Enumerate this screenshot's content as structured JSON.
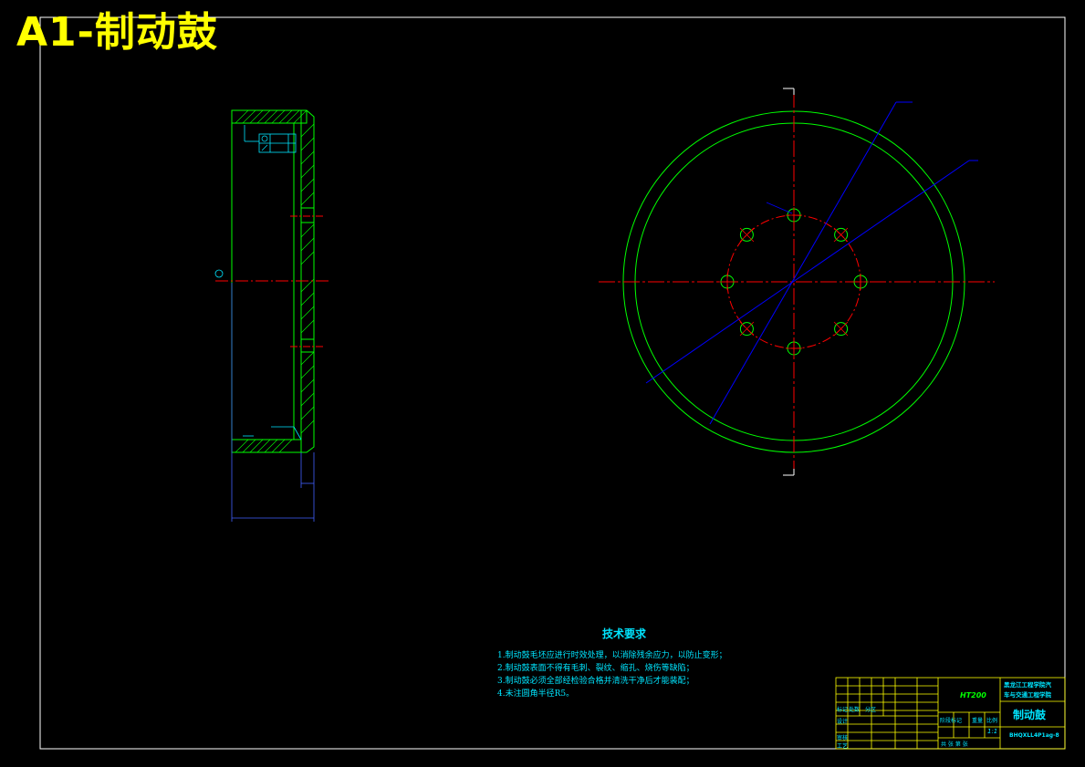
{
  "drawing": {
    "title": "A1-制动鼓",
    "colors": {
      "background": "#000000",
      "frame": "#ffffff",
      "outline": "#00ff00",
      "centerline": "#ff0000",
      "dimension": "#00e5ff",
      "leader": "#0000ff",
      "title": "#ffff00"
    }
  },
  "technical_requirements": {
    "heading": "技术要求",
    "items": [
      "1.制动鼓毛坯应进行时效处理，以消除残余应力，以防止变形；",
      "2.制动鼓表面不得有毛刺、裂纹、缩孔、烧伤等缺陷；",
      "3.制动鼓必须全部经检验合格并清洗干净后才能装配；",
      "4.未注圆角半径R5。"
    ]
  },
  "title_block": {
    "school_line1": "黑龙江工程学院汽",
    "school_line2": "车与交通工程学院",
    "part_name": "制动鼓",
    "material": "HT200",
    "drawing_code": "BHQXLL4P1ag-8",
    "scale": "1:1",
    "cols_label": "阶段标记",
    "weight_label": "重量",
    "ratio_label": "比例",
    "sheet_info": "共 张  第 张",
    "design_label": "设计",
    "mark_label": "标记",
    "count_label": "处数",
    "zone_label": "分区",
    "review_label": "审核",
    "process_label": "工艺"
  }
}
